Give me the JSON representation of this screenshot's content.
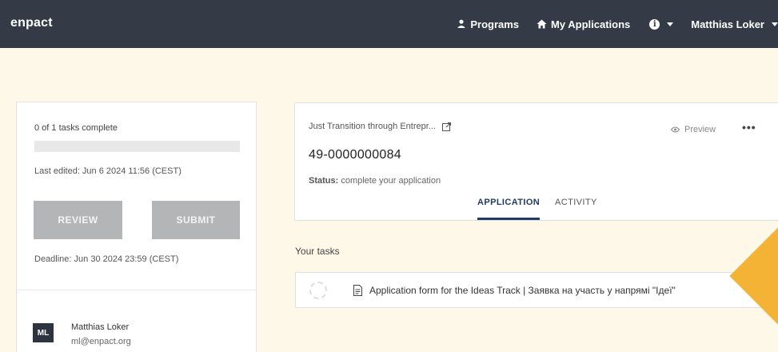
{
  "topbar": {
    "brand": "enpact",
    "programs_label": "Programs",
    "my_applications_label": "My Applications",
    "info_label": "i",
    "user_name": "Matthias Loker"
  },
  "sidebar": {
    "tasks_count": "0 of 1 tasks complete",
    "progress": 0,
    "last_edited": "Last edited: Jun 6 2024 11:56 (CEST)",
    "review_label": "REVIEW",
    "submit_label": "SUBMIT",
    "deadline": "Deadline: Jun 30 2024 23:59 (CEST)",
    "user": {
      "initials": "ML",
      "name": "Matthias Loker",
      "email": "ml@enpact.org"
    }
  },
  "application": {
    "program_name": "Just Transition through Entrepr...",
    "preview_label": "Preview",
    "more_label": "•••",
    "id": "49-0000000084",
    "status_label": "Status:",
    "status_value": "complete your application",
    "tabs": [
      {
        "label": "APPLICATION",
        "active": true
      },
      {
        "label": "ACTIVITY",
        "active": false
      }
    ]
  },
  "tasks": {
    "heading": "Your tasks",
    "items": [
      {
        "label": "Application form for the Ideas Track | Заявка на участь у напрямі \"Ідеї\"",
        "complete": false
      }
    ]
  },
  "colors": {
    "topbar": "#343b47",
    "background": "#fdf8e8",
    "accent": "#1f3b66",
    "button_disabled": "#b3b5b7",
    "diamond": "#f5b335"
  }
}
